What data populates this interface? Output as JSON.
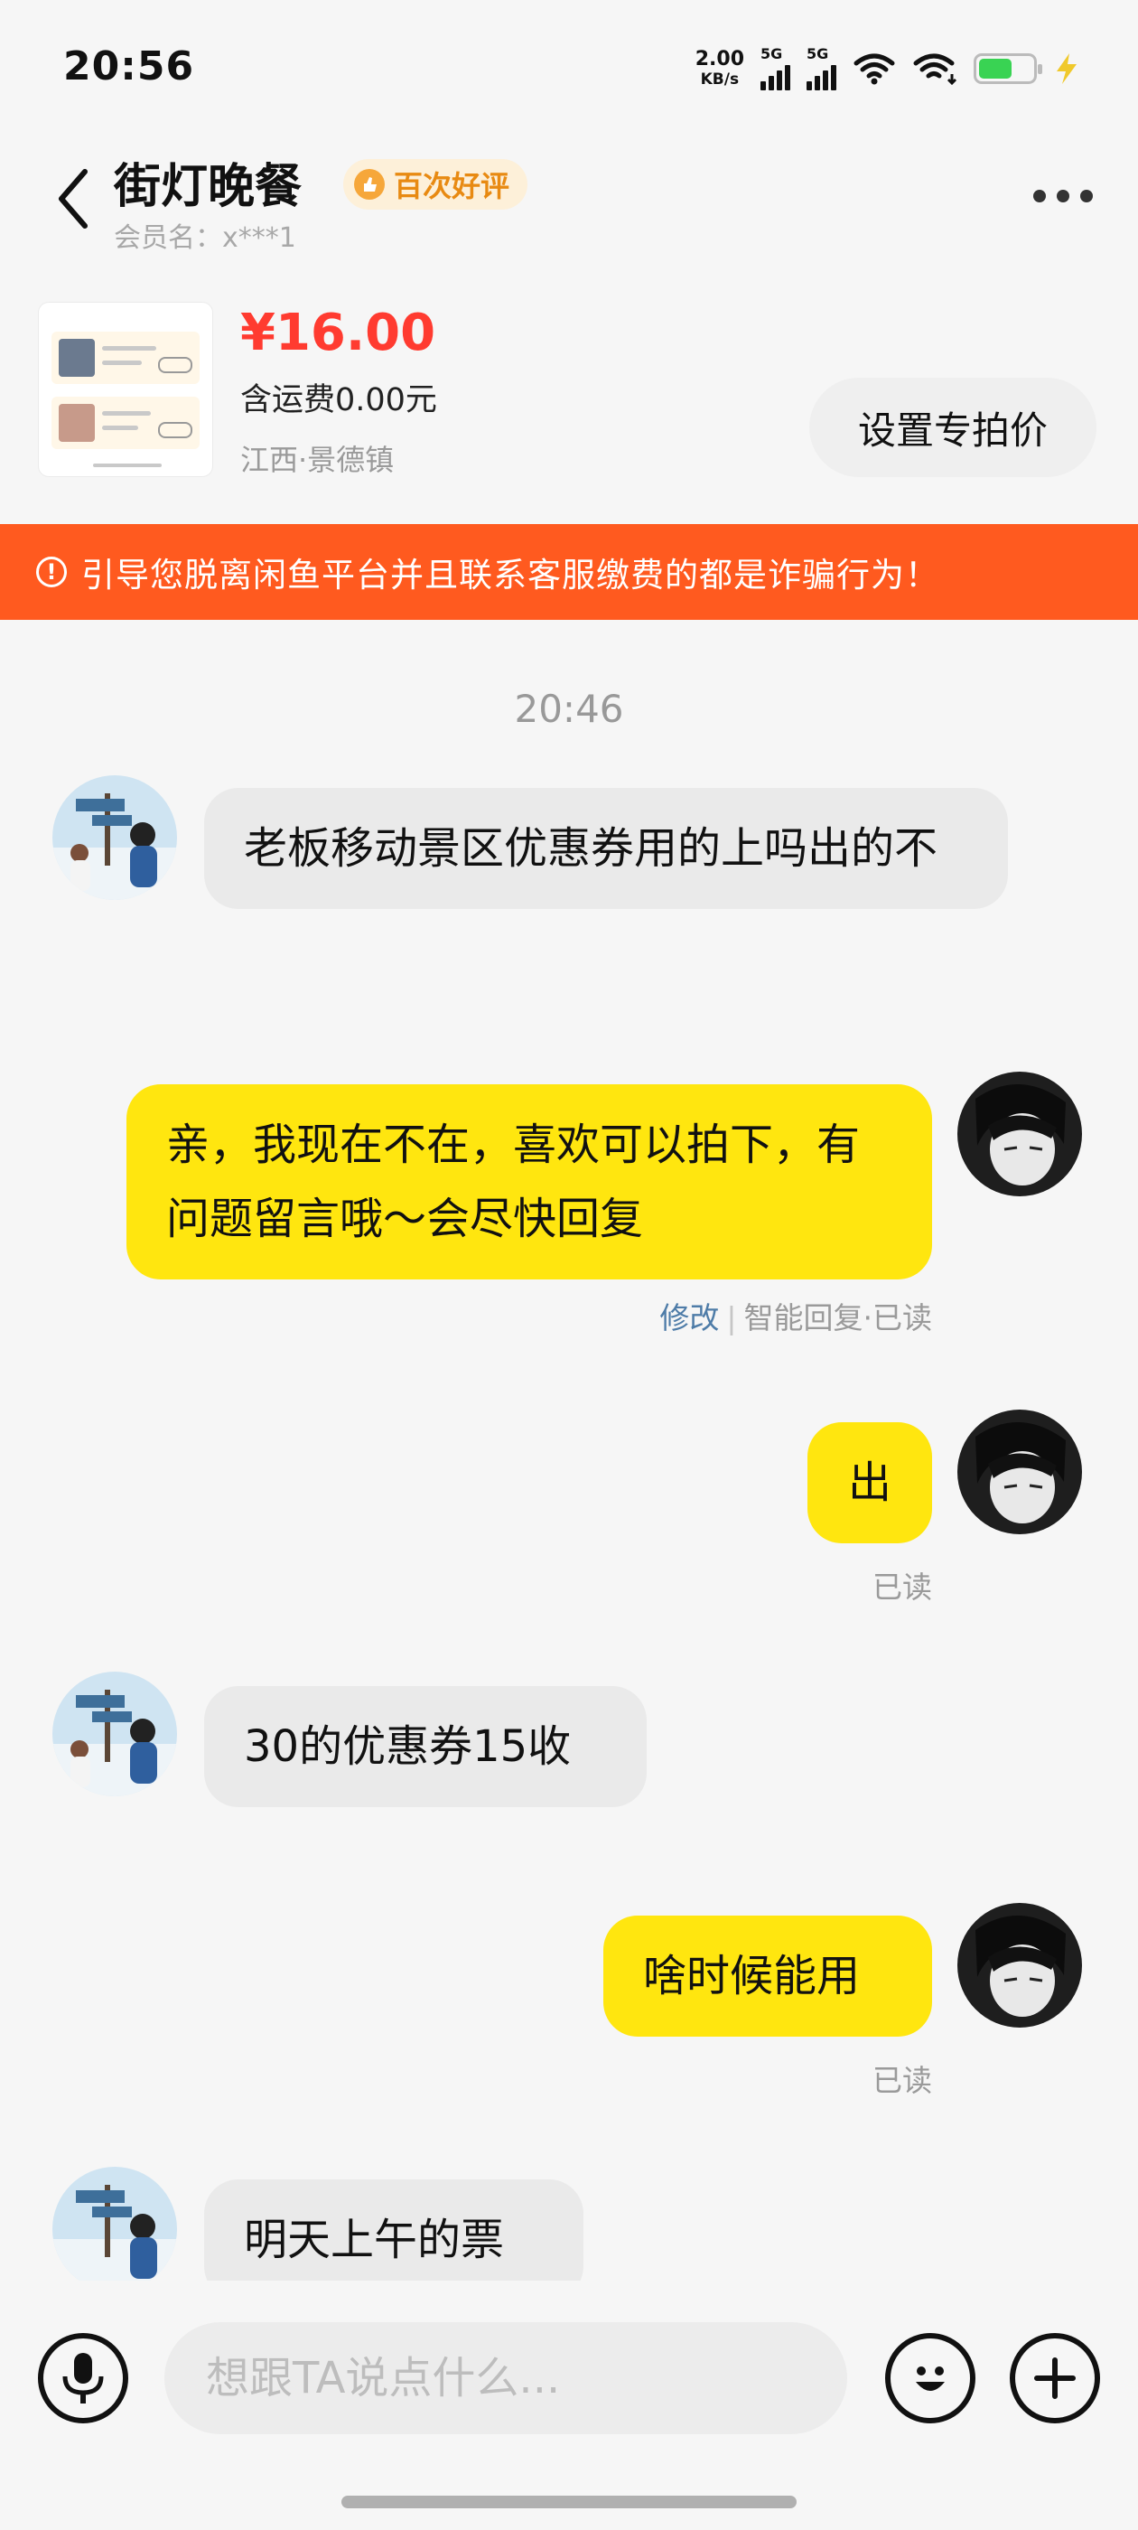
{
  "status_bar": {
    "time": "20:56",
    "net_speed_value": "2.00",
    "net_speed_unit": "KB/s",
    "signal1_label": "5G",
    "signal2_label": "5G",
    "battery_level": 0.6,
    "battery_color": "#39d353"
  },
  "header": {
    "seller_name": "街灯晚餐",
    "badge_label": "百次好评",
    "member_label": "会员名：x***1",
    "back_icon": "chevron-left-icon",
    "more_icon": "more-dots-icon"
  },
  "product": {
    "price": "¥16.00",
    "shipping": "含运费0.00元",
    "location": "江西·景德镇",
    "special_price_button": "设置专拍价"
  },
  "warning": {
    "text": "引导您脱离闲鱼平台并且联系客服缴费的都是诈骗行为！",
    "icon": "alert-circle-icon",
    "color": "#ff5a1f"
  },
  "chat": {
    "time_separator": "20:46",
    "messages": [
      {
        "direction": "in",
        "text": "老板移动景区优惠券用的上吗出的不"
      },
      {
        "direction": "out",
        "text": "亲，我现在不在，喜欢可以拍下，有问题留言哦～会尽快回复",
        "meta_edit": "修改",
        "meta_sep": "|",
        "meta_status": "智能回复·已读"
      },
      {
        "direction": "out",
        "text": "出",
        "meta_status": "已读"
      },
      {
        "direction": "in",
        "text": "30的优惠券15收"
      },
      {
        "direction": "out",
        "text": "啥时候能用",
        "meta_status": "已读"
      },
      {
        "direction": "in",
        "text": "明天上午的票"
      }
    ],
    "bubble_out_color": "#ffe60f",
    "bubble_in_color": "#eaeaea"
  },
  "input_bar": {
    "placeholder": "想跟TA说点什么...",
    "voice_icon": "microphone-icon",
    "emoji_icon": "emoji-icon",
    "plus_icon": "plus-icon"
  }
}
